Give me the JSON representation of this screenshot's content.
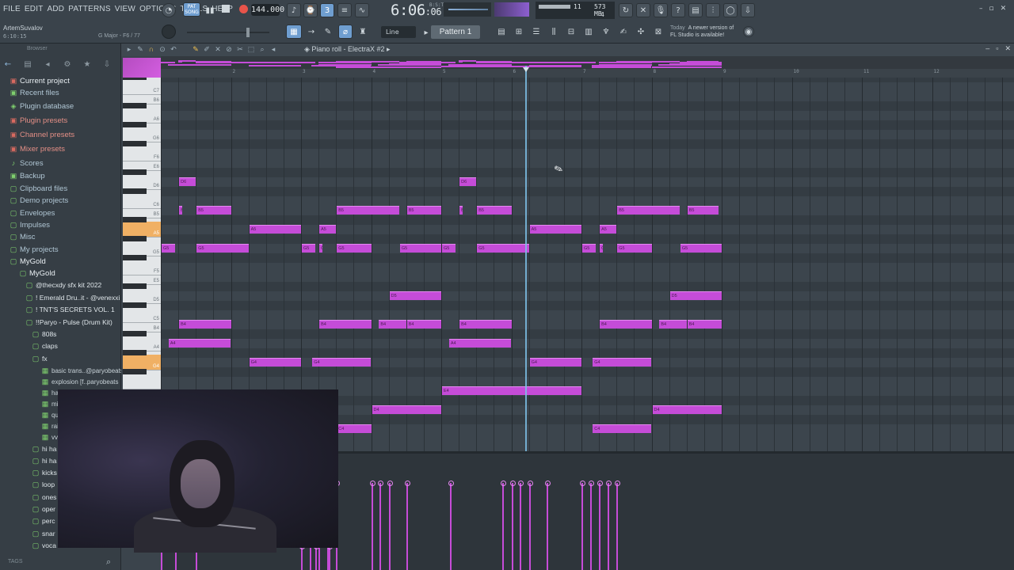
{
  "menu": [
    "FILE",
    "EDIT",
    "ADD",
    "PATTERNS",
    "VIEW",
    "OPTIONS",
    "TOOLS",
    "HELP"
  ],
  "transport": {
    "mode_top": "PAT",
    "mode_bottom": "SONG",
    "tempo": "144.000",
    "time": "6:06",
    "time_ticks": ":06",
    "time_sub": "B:S:T"
  },
  "cpu": {
    "value1": "11",
    "memory": "573 MB",
    "voices": "4"
  },
  "user": {
    "name": "ArtemSuvalov",
    "time": "6:10:15",
    "keysig": "G Major - F6 / 77"
  },
  "snap": "Line",
  "pattern": "Pattern 1",
  "news": {
    "when": "Today",
    "line1": "A newer version of",
    "line2": "FL Studio is available!"
  },
  "browser": {
    "header": "Browser",
    "items": [
      {
        "label": "Current project",
        "style": "red bright",
        "icon": "▣"
      },
      {
        "label": "Recent files",
        "style": "",
        "icon": "▣"
      },
      {
        "label": "Plugin database",
        "style": "",
        "icon": "◈"
      },
      {
        "label": "Plugin presets",
        "style": "red",
        "icon": "▣"
      },
      {
        "label": "Channel presets",
        "style": "red",
        "icon": "▣"
      },
      {
        "label": "Mixer presets",
        "style": "red",
        "icon": "▣"
      },
      {
        "label": "Scores",
        "style": "",
        "icon": "♪"
      },
      {
        "label": "Backup",
        "style": "",
        "icon": "▣"
      },
      {
        "label": "Clipboard files",
        "style": "",
        "icon": "▢"
      },
      {
        "label": "Demo projects",
        "style": "",
        "icon": "▢"
      },
      {
        "label": "Envelopes",
        "style": "",
        "icon": "▢"
      },
      {
        "label": "Impulses",
        "style": "",
        "icon": "▢"
      },
      {
        "label": "Misc",
        "style": "",
        "icon": "▢"
      },
      {
        "label": "My projects",
        "style": "",
        "icon": "▢"
      },
      {
        "label": "MyGold",
        "style": "bright",
        "icon": "▢"
      },
      {
        "label": "MyGold",
        "style": "bright",
        "icon": "▢"
      },
      {
        "label": "@thecxdy sfx kit 2022",
        "style": "white",
        "icon": "▢"
      },
      {
        "label": "! Emerald Dru..it - @venexxi",
        "style": "white",
        "icon": "▢"
      },
      {
        "label": "! TNT'S SECRETS VOL. 1",
        "style": "white",
        "icon": "▢"
      },
      {
        "label": "!!Paryo - Pulse (Drum Kit)",
        "style": "white bright",
        "icon": "▢"
      },
      {
        "label": "808s",
        "style": "white",
        "icon": "▢"
      },
      {
        "label": "claps",
        "style": "white",
        "icon": "▢"
      },
      {
        "label": "fx",
        "style": "white",
        "icon": "▢"
      },
      {
        "label": "basic trans..@paryobeats",
        "style": "small",
        "icon": "▦"
      },
      {
        "label": "explosion [f..paryobeats",
        "style": "small",
        "icon": "▦"
      },
      {
        "label": "ha",
        "style": "small",
        "icon": "▦"
      },
      {
        "label": "mi",
        "style": "small",
        "icon": "▦"
      },
      {
        "label": "qu",
        "style": "small",
        "icon": "▦"
      },
      {
        "label": "rai",
        "style": "small",
        "icon": "▦"
      },
      {
        "label": "vv",
        "style": "small",
        "icon": "▦"
      },
      {
        "label": "hi ha",
        "style": "white",
        "icon": "▢"
      },
      {
        "label": "hi ha",
        "style": "white",
        "icon": "▢"
      },
      {
        "label": "kicks",
        "style": "white",
        "icon": "▢"
      },
      {
        "label": "loop",
        "style": "white",
        "icon": "▢"
      },
      {
        "label": "ones",
        "style": "white",
        "icon": "▢"
      },
      {
        "label": "oper",
        "style": "white",
        "icon": "▢"
      },
      {
        "label": "perc",
        "style": "white",
        "icon": "▢"
      },
      {
        "label": "snar",
        "style": "white",
        "icon": "▢"
      },
      {
        "label": "voca",
        "style": "white",
        "icon": "▢"
      }
    ],
    "tags": "TAGS"
  },
  "piano_roll": {
    "title": "Piano roll - ElectraX #2",
    "ruler": [
      "2",
      "3",
      "4",
      "5",
      "6",
      "7",
      "8",
      "9",
      "10",
      "11",
      "12"
    ],
    "keys": [
      "C7",
      "B6",
      "A6",
      "G6",
      "F6",
      "E6",
      "D6",
      "C6",
      "B5",
      "A5",
      "G5",
      "F5",
      "E5",
      "D5",
      "C5",
      "B4",
      "A4",
      "G4"
    ],
    "highlight_keys": [
      "A5",
      "G4"
    ],
    "notes": [
      {
        "pitch": "D6",
        "start": 1.25,
        "len": 0.25
      },
      {
        "pitch": "D6",
        "start": 5.25,
        "len": 0.25
      },
      {
        "pitch": "B5",
        "start": 1.25,
        "len": 0.05
      },
      {
        "pitch": "B5",
        "start": 1.5,
        "len": 0.5
      },
      {
        "pitch": "B5",
        "start": 3.5,
        "len": 0.9
      },
      {
        "pitch": "B5",
        "start": 4.5,
        "len": 0.5
      },
      {
        "pitch": "B5",
        "start": 5.25,
        "len": 0.05
      },
      {
        "pitch": "B5",
        "start": 5.5,
        "len": 0.5
      },
      {
        "pitch": "B5",
        "start": 7.5,
        "len": 0.9
      },
      {
        "pitch": "B5",
        "start": 8.5,
        "len": 0.45
      },
      {
        "pitch": "A5",
        "start": 2.25,
        "len": 0.75
      },
      {
        "pitch": "A5",
        "start": 3.25,
        "len": 0.25
      },
      {
        "pitch": "A5",
        "start": 6.25,
        "len": 0.75
      },
      {
        "pitch": "A5",
        "start": 7.25,
        "len": 0.25
      },
      {
        "pitch": "G5",
        "start": 1.0,
        "len": 0.2
      },
      {
        "pitch": "G5",
        "start": 1.5,
        "len": 0.75
      },
      {
        "pitch": "G5",
        "start": 3.0,
        "len": 0.2
      },
      {
        "pitch": "G5",
        "start": 3.25,
        "len": 0.05
      },
      {
        "pitch": "G5",
        "start": 3.5,
        "len": 0.5
      },
      {
        "pitch": "G5",
        "start": 4.4,
        "len": 0.6
      },
      {
        "pitch": "G5",
        "start": 5.0,
        "len": 0.2
      },
      {
        "pitch": "G5",
        "start": 5.5,
        "len": 0.75
      },
      {
        "pitch": "G5",
        "start": 7.0,
        "len": 0.2
      },
      {
        "pitch": "G5",
        "start": 7.25,
        "len": 0.05
      },
      {
        "pitch": "G5",
        "start": 7.5,
        "len": 0.5
      },
      {
        "pitch": "G5",
        "start": 8.4,
        "len": 0.6
      },
      {
        "pitch": "D5",
        "start": 4.25,
        "len": 0.75
      },
      {
        "pitch": "D5",
        "start": 8.25,
        "len": 0.75
      },
      {
        "pitch": "B4",
        "start": 1.25,
        "len": 0.75
      },
      {
        "pitch": "B4",
        "start": 3.25,
        "len": 0.75
      },
      {
        "pitch": "B4",
        "start": 4.1,
        "len": 0.4
      },
      {
        "pitch": "B4",
        "start": 4.5,
        "len": 0.5
      },
      {
        "pitch": "B4",
        "start": 5.25,
        "len": 0.75
      },
      {
        "pitch": "B4",
        "start": 7.25,
        "len": 0.75
      },
      {
        "pitch": "B4",
        "start": 8.1,
        "len": 0.4
      },
      {
        "pitch": "B4",
        "start": 8.5,
        "len": 0.5
      },
      {
        "pitch": "A4",
        "start": 1.1,
        "len": 0.9
      },
      {
        "pitch": "A4",
        "start": 5.1,
        "len": 0.9
      },
      {
        "pitch": "G4",
        "start": 2.25,
        "len": 0.75
      },
      {
        "pitch": "G4",
        "start": 3.15,
        "len": 0.85
      },
      {
        "pitch": "G4",
        "start": 6.25,
        "len": 0.75
      },
      {
        "pitch": "G4",
        "start": 7.15,
        "len": 0.85
      },
      {
        "pitch": "E4",
        "start": 5.0,
        "len": 2.0
      },
      {
        "pitch": "D4",
        "start": 4.0,
        "len": 1.0
      },
      {
        "pitch": "D4",
        "start": 8.0,
        "len": 1.0
      },
      {
        "pitch": "C4",
        "start": 3.5,
        "len": 0.5
      },
      {
        "pitch": "C4",
        "start": 7.15,
        "len": 0.85
      }
    ],
    "velocity_lines": [
      3.0,
      3.12,
      3.25,
      3.37,
      3.5,
      4.0,
      4.12,
      4.25,
      4.5,
      5.12,
      5.87,
      6.0,
      6.12,
      6.25,
      6.5,
      7.0,
      7.12,
      7.25,
      7.37,
      7.5
    ],
    "playhead": 6.2
  }
}
